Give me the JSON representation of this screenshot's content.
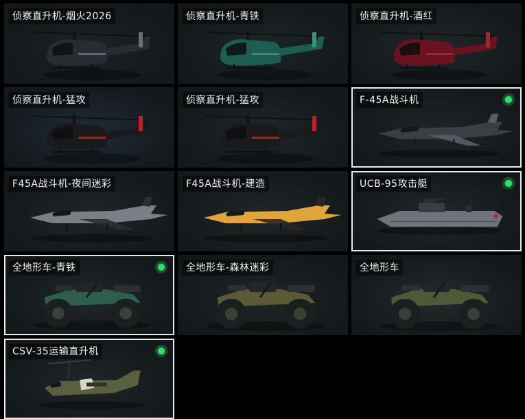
{
  "vehicles": [
    {
      "title": "侦察直升机-烟火2026",
      "kind": "heli",
      "body": "#2a2c33",
      "accent": "#6b6f7a",
      "bg": "#1c2226",
      "owned": false,
      "selected": false
    },
    {
      "title": "侦察直升机-青铁",
      "kind": "heli",
      "body": "#1d5e52",
      "accent": "#3f8f7f",
      "bg": "#1c2528",
      "owned": false,
      "selected": false
    },
    {
      "title": "侦察直升机-酒红",
      "kind": "heli",
      "body": "#6a1320",
      "accent": "#9a2a36",
      "bg": "#20262a",
      "owned": false,
      "selected": false
    },
    {
      "title": "侦察直升机-猛攻",
      "kind": "heli",
      "body": "#1a1a1c",
      "accent": "#c21e26",
      "bg": "#1f2b38",
      "owned": false,
      "selected": false
    },
    {
      "title": "侦察直升机-猛攻",
      "kind": "heli",
      "body": "#1a1a1c",
      "accent": "#c21e26",
      "bg": "#1e2629",
      "owned": false,
      "selected": false
    },
    {
      "title": "F-45A战斗机",
      "kind": "jet",
      "body": "#3b3e44",
      "accent": "#5a5e66",
      "bg": "#1f2427",
      "owned": true,
      "selected": true
    },
    {
      "title": "F45A战斗机-夜间迷彩",
      "kind": "jet",
      "body": "#7a7f86",
      "accent": "#2b2d31",
      "bg": "#1e2528",
      "owned": false,
      "selected": false
    },
    {
      "title": "F45A战斗机-建造",
      "kind": "jet",
      "body": "#e0a53a",
      "accent": "#2a2722",
      "bg": "#1f2628",
      "owned": false,
      "selected": false
    },
    {
      "title": "UCB-95攻击艇",
      "kind": "boat",
      "body": "#6e747b",
      "accent": "#3a3e43",
      "bg": "#20272a",
      "owned": true,
      "selected": true
    },
    {
      "title": "全地形车-青铁",
      "kind": "atv",
      "body": "#2e5e4e",
      "accent": "#3c3f3f",
      "bg": "#1f2629",
      "owned": true,
      "selected": true
    },
    {
      "title": "全地形车-森林迷彩",
      "kind": "atv",
      "body": "#5a5a36",
      "accent": "#3a4032",
      "bg": "#1f2628",
      "owned": false,
      "selected": false
    },
    {
      "title": "全地形车",
      "kind": "atv",
      "body": "#4b5b38",
      "accent": "#3a3e36",
      "bg": "#232a2d",
      "owned": false,
      "selected": false
    },
    {
      "title": "CSV-35运输直升机",
      "kind": "tilt",
      "body": "#5a5f3f",
      "accent": "#d8d8c8",
      "bg": "#1f2628",
      "owned": true,
      "selected": true
    }
  ]
}
